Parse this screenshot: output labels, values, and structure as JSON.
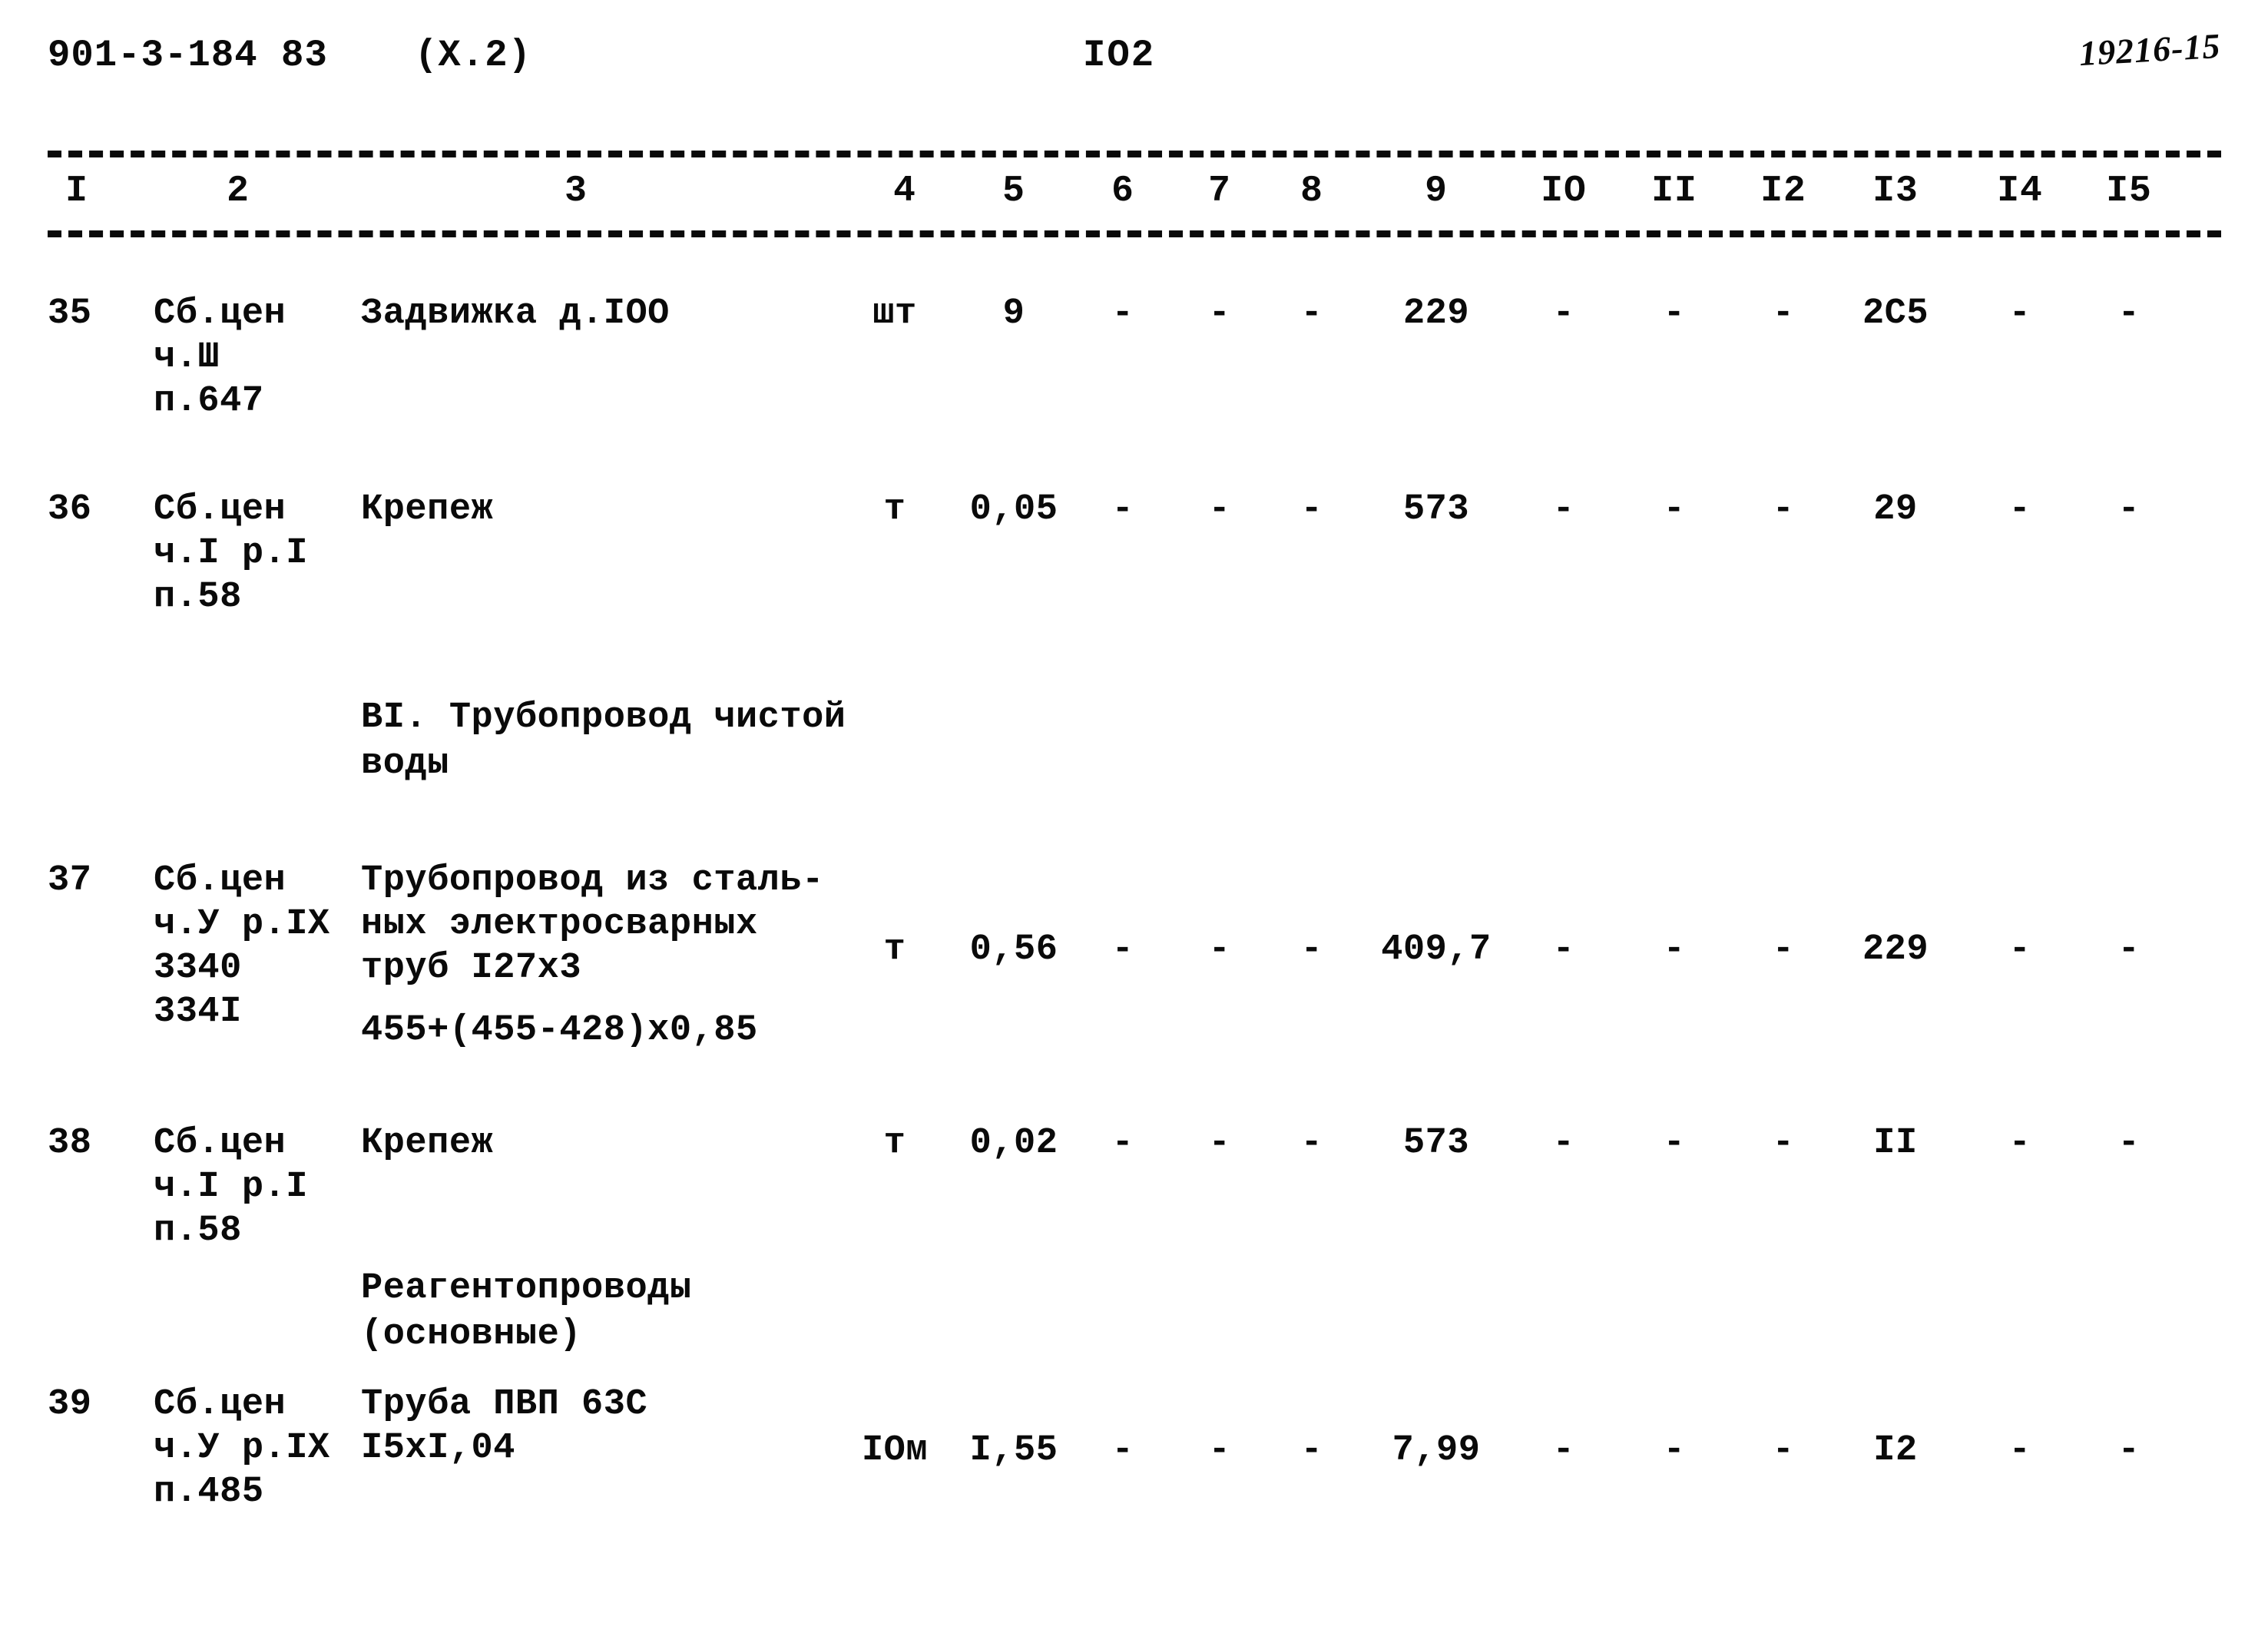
{
  "header": {
    "doc_number": "901-3-184 83",
    "part": "(X.2)",
    "page_number": "IO2",
    "archive_stamp": "19216-15"
  },
  "table": {
    "column_headers": [
      "I",
      "2",
      "3",
      "4",
      "5",
      "6",
      "7",
      "8",
      "9",
      "IO",
      "II",
      "I2",
      "I3",
      "I4",
      "I5"
    ],
    "rows": [
      {
        "num": "35",
        "code": "Сб.цен\nч.Ш\nп.647",
        "description": "Задвижка д.IOO",
        "unit": "шт",
        "c5": "9",
        "c6": "-",
        "c7": "-",
        "c8": "-",
        "c9": "229",
        "c10": "-",
        "c11": "-",
        "c12": "-",
        "c13": "2C5",
        "c14": "-",
        "c15": "-"
      },
      {
        "num": "36",
        "code": "Сб.цен\nч.I р.I\nп.58",
        "description": "Крепеж",
        "unit": "т",
        "c5": "0,05",
        "c6": "-",
        "c7": "-",
        "c8": "-",
        "c9": "573",
        "c10": "-",
        "c11": "-",
        "c12": "-",
        "c13": "29",
        "c14": "-",
        "c15": "-"
      },
      {
        "num": "37",
        "code": "Сб.цен\nч.У р.IX\n3340\n334I",
        "description": "Трубопровод из сталь-\nных электросварных\nтруб I27х3",
        "unit": "т",
        "c5": "0,56",
        "c6": "-",
        "c7": "-",
        "c8": "-",
        "c9": "409,7",
        "c10": "-",
        "c11": "-",
        "c12": "-",
        "c13": "229",
        "c14": "-",
        "c15": "-"
      },
      {
        "num": "38",
        "code": "Сб.цен\nч.I р.I\nп.58",
        "description": "Крепеж",
        "unit": "т",
        "c5": "0,02",
        "c6": "-",
        "c7": "-",
        "c8": "-",
        "c9": "573",
        "c10": "-",
        "c11": "-",
        "c12": "-",
        "c13": "II",
        "c14": "-",
        "c15": "-"
      },
      {
        "num": "39",
        "code": "Сб.цен\nч.У р.IX\nп.485",
        "description": "Труба ПВП 63С\nI5хI,04",
        "unit": "IOм",
        "c5": "I,55",
        "c6": "-",
        "c7": "-",
        "c8": "-",
        "c9": "7,99",
        "c10": "-",
        "c11": "-",
        "c12": "-",
        "c13": "I2",
        "c14": "-",
        "c15": "-"
      }
    ]
  },
  "sections": {
    "clean_water_pipeline": "ВI. Трубопровод чистой\n            воды",
    "reagent_pipelines": "Реагентопроводы\n(основные)"
  },
  "annotations": {
    "row37_formula": "455+(455-428)х0,85"
  }
}
